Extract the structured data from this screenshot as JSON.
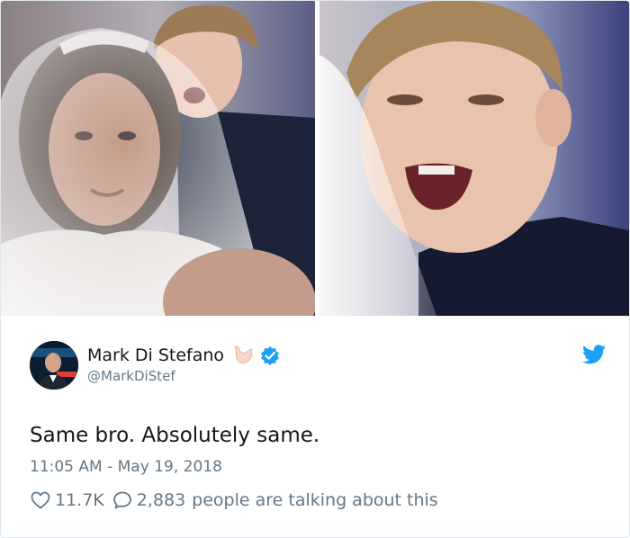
{
  "tweet": {
    "author": {
      "display_name": "Mark Di Stefano",
      "handle": "@MarkDiStef",
      "emoji": "call-me-hand-emoji",
      "verified": true
    },
    "text": "Same bro. Absolutely same.",
    "timestamp": "11:05 AM - May 19, 2018",
    "likes": "11.7K",
    "replies_count": "2,883",
    "talking_label": "people are talking about this"
  },
  "colors": {
    "twitter_blue": "#1da1f2",
    "text_primary": "#14171a",
    "text_secondary": "#657786",
    "border": "#e1e8ed"
  },
  "icons": {
    "like": "heart-icon",
    "reply": "speech-bubble-icon",
    "brand": "twitter-bird-icon",
    "verified": "verified-badge-icon"
  }
}
